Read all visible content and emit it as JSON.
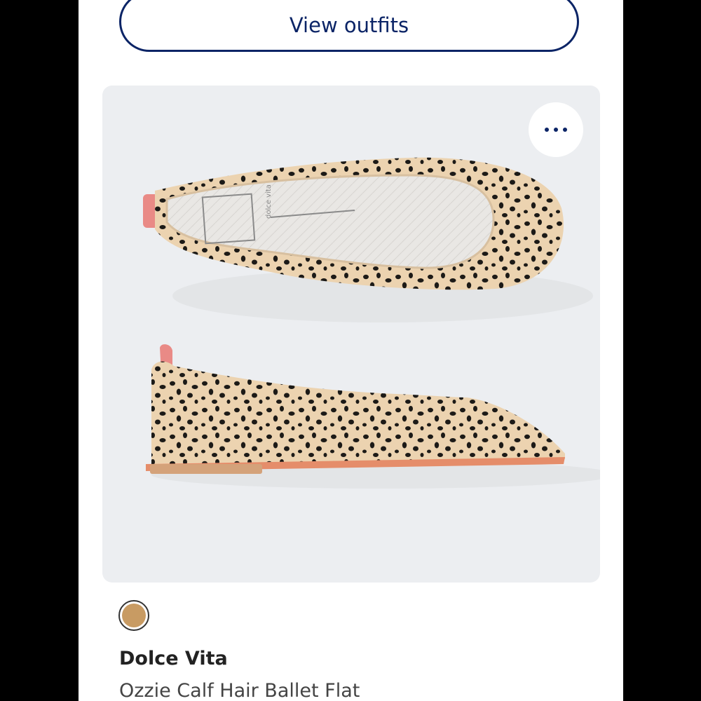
{
  "header": {
    "view_outfits_label": "View outfits"
  },
  "product": {
    "more_icon": "more-horizontal-icon",
    "swatch_color": "#c89b63",
    "brand": "Dolce Vita",
    "name": "Ozzie Calf Hair Ballet Flat",
    "insole_brand_mark": "dolce vita"
  },
  "colors": {
    "accent": "#0b2466",
    "card_bg": "#eceef1",
    "leopard_base": "#ecd3b0",
    "spot": "#1c1a17",
    "heel_tab": "#e98a86"
  }
}
